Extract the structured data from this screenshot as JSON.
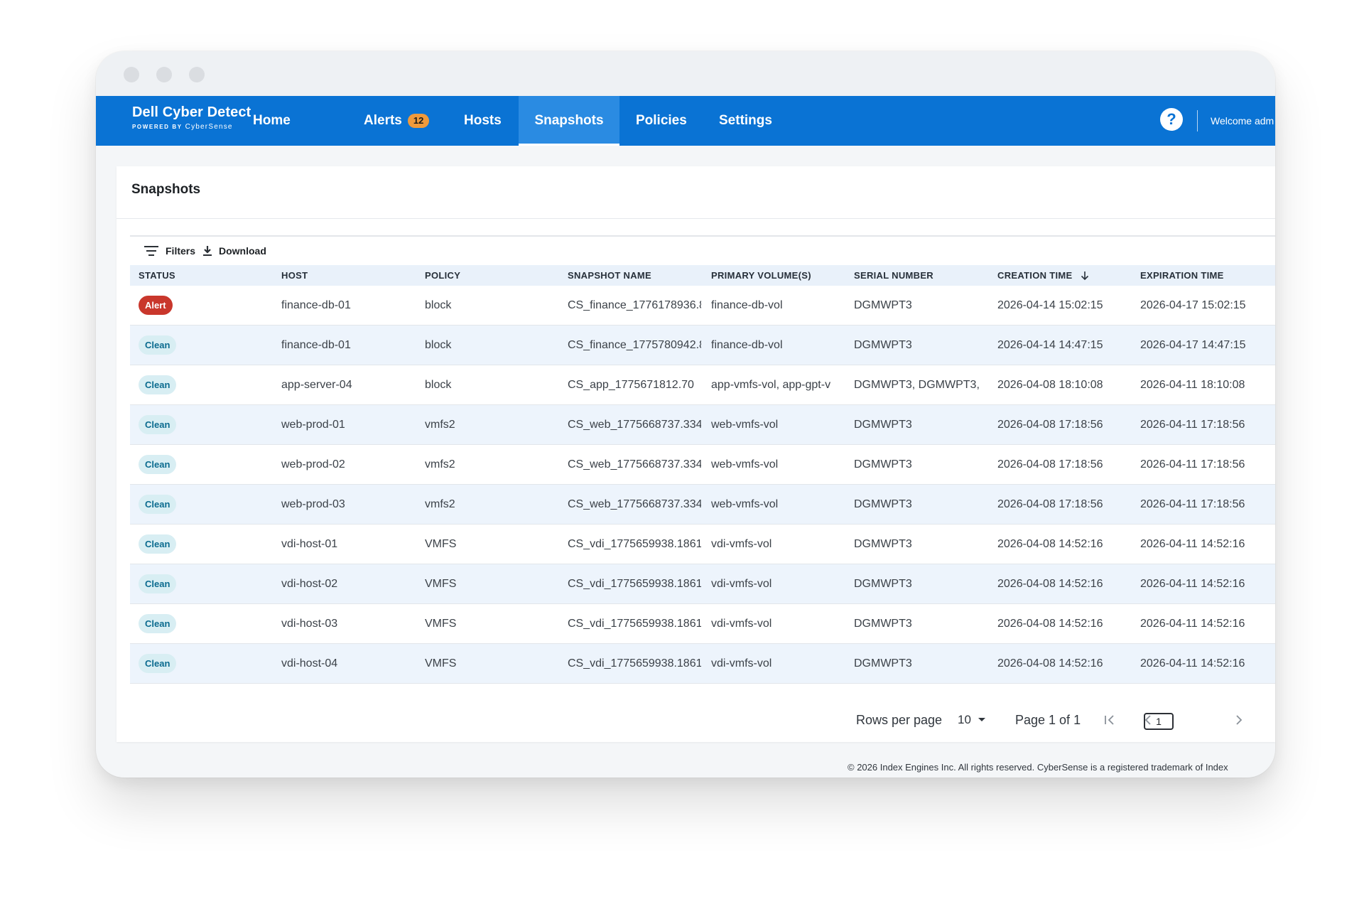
{
  "brand": {
    "title": "Dell Cyber Detect",
    "powered_by": "POWERED BY",
    "product": "CyberSense"
  },
  "nav": {
    "items": [
      {
        "label": "Home"
      },
      {
        "label": "Alerts",
        "badge": "12"
      },
      {
        "label": "Hosts"
      },
      {
        "label": "Snapshots",
        "active": true
      },
      {
        "label": "Policies"
      },
      {
        "label": "Settings"
      }
    ],
    "help_icon": "question-circle-icon",
    "welcome": "Welcome adm"
  },
  "page": {
    "title": "Snapshots"
  },
  "toolbar": {
    "filters_label": "Filters",
    "download_label": "Download"
  },
  "table": {
    "columns": [
      "STATUS",
      "HOST",
      "POLICY",
      "SNAPSHOT NAME",
      "PRIMARY VOLUME(S)",
      "SERIAL NUMBER",
      "CREATION TIME",
      "EXPIRATION TIME"
    ],
    "sort_column": "CREATION TIME",
    "sort_direction": "descending",
    "rows": [
      {
        "status": "Alert",
        "host": "finance-db-01",
        "policy": "block",
        "snapshot": "CS_finance_1776178936.8",
        "volumes": "finance-db-vol",
        "serial": "DGMWPT3",
        "created": "2026-04-14 15:02:15",
        "expires": "2026-04-17 15:02:15"
      },
      {
        "status": "Clean",
        "host": "finance-db-01",
        "policy": "block",
        "snapshot": "CS_finance_1775780942.8",
        "volumes": "finance-db-vol",
        "serial": "DGMWPT3",
        "created": "2026-04-14 14:47:15",
        "expires": "2026-04-17 14:47:15"
      },
      {
        "status": "Clean",
        "host": "app-server-04",
        "policy": "block",
        "snapshot": "CS_app_1775671812.70",
        "volumes": "app-vmfs-vol, app-gpt-v",
        "serial": "DGMWPT3, DGMWPT3,",
        "created": "2026-04-08 18:10:08",
        "expires": "2026-04-11 18:10:08"
      },
      {
        "status": "Clean",
        "host": "web-prod-01",
        "policy": "vmfs2",
        "snapshot": "CS_web_1775668737.334",
        "volumes": "web-vmfs-vol",
        "serial": "DGMWPT3",
        "created": "2026-04-08 17:18:56",
        "expires": "2026-04-11 17:18:56"
      },
      {
        "status": "Clean",
        "host": "web-prod-02",
        "policy": "vmfs2",
        "snapshot": "CS_web_1775668737.334",
        "volumes": "web-vmfs-vol",
        "serial": "DGMWPT3",
        "created": "2026-04-08 17:18:56",
        "expires": "2026-04-11 17:18:56"
      },
      {
        "status": "Clean",
        "host": "web-prod-03",
        "policy": "vmfs2",
        "snapshot": "CS_web_1775668737.334",
        "volumes": "web-vmfs-vol",
        "serial": "DGMWPT3",
        "created": "2026-04-08 17:18:56",
        "expires": "2026-04-11 17:18:56"
      },
      {
        "status": "Clean",
        "host": "vdi-host-01",
        "policy": "VMFS",
        "snapshot": "CS_vdi_1775659938.1861",
        "volumes": "vdi-vmfs-vol",
        "serial": "DGMWPT3",
        "created": "2026-04-08 14:52:16",
        "expires": "2026-04-11 14:52:16"
      },
      {
        "status": "Clean",
        "host": "vdi-host-02",
        "policy": "VMFS",
        "snapshot": "CS_vdi_1775659938.1861",
        "volumes": "vdi-vmfs-vol",
        "serial": "DGMWPT3",
        "created": "2026-04-08 14:52:16",
        "expires": "2026-04-11 14:52:16"
      },
      {
        "status": "Clean",
        "host": "vdi-host-03",
        "policy": "VMFS",
        "snapshot": "CS_vdi_1775659938.1861",
        "volumes": "vdi-vmfs-vol",
        "serial": "DGMWPT3",
        "created": "2026-04-08 14:52:16",
        "expires": "2026-04-11 14:52:16"
      },
      {
        "status": "Clean",
        "host": "vdi-host-04",
        "policy": "VMFS",
        "snapshot": "CS_vdi_1775659938.1861",
        "volumes": "vdi-vmfs-vol",
        "serial": "DGMWPT3",
        "created": "2026-04-08 14:52:16",
        "expires": "2026-04-11 14:52:16"
      }
    ]
  },
  "pagination": {
    "rows_per_page_label": "Rows per page",
    "rows_per_page_value": "10",
    "page_info": "Page 1 of 1",
    "current_page": "1"
  },
  "footer": {
    "text": "© 2026 Index Engines Inc. All rights reserved. CyberSense is a registered trademark of Index "
  },
  "colors": {
    "nav_bg": "#0a73d4",
    "nav_active": "#2a8be2",
    "badge": "#ef9a3c",
    "alert_pill": "#c9372c",
    "clean_pill_bg": "#d8eef3",
    "clean_pill_text": "#0b6b8f",
    "row_alt": "#edf4fc"
  }
}
